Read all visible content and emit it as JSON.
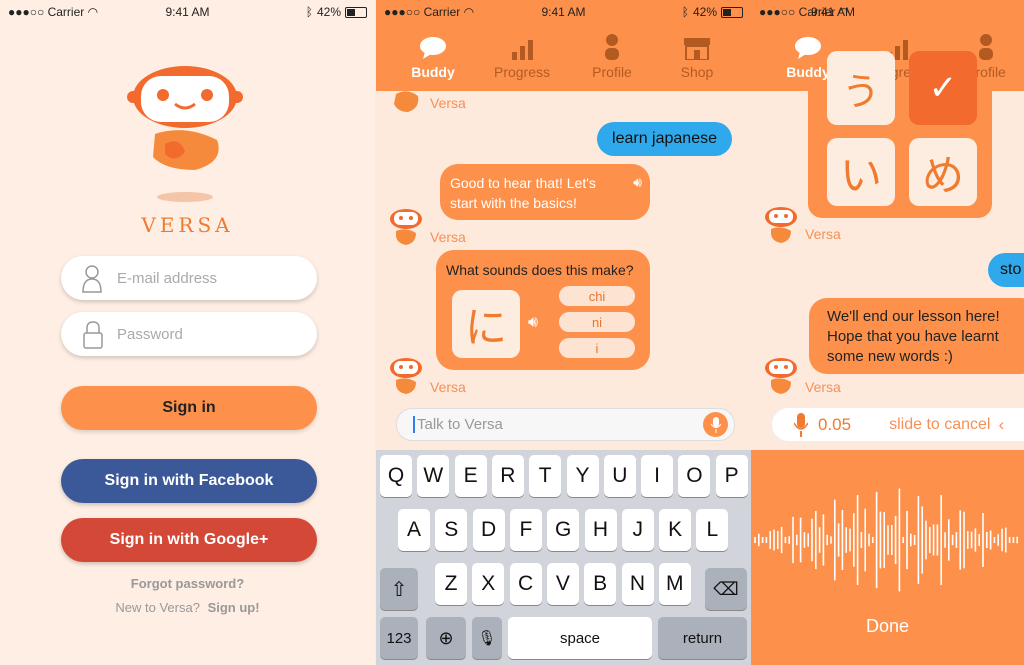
{
  "status": {
    "carrier": "●●●○○ Carrier",
    "time": "9:41 AM",
    "battery": "42%"
  },
  "login": {
    "brand": "VERSA",
    "email_placeholder": "E-mail address",
    "password_placeholder": "Password",
    "signin": "Sign in",
    "facebook": "Sign in with Facebook",
    "google": "Sign in with Google+",
    "forgot": "Forgot password?",
    "new_prompt": "New to Versa?",
    "signup": "Sign up!"
  },
  "nav": {
    "tabs": [
      "Buddy",
      "Progress",
      "Profile",
      "Shop"
    ]
  },
  "chat": {
    "sender": "Versa",
    "user_msg": "learn japanese",
    "bot_msg1": "Good to hear that! Let's start with the basics!",
    "question": "What sounds does this make?",
    "kana": "に",
    "options": [
      "chi",
      "ni",
      "i"
    ],
    "input_placeholder": "Talk to Versa"
  },
  "keyboard": {
    "row1": [
      "Q",
      "W",
      "E",
      "R",
      "T",
      "Y",
      "U",
      "I",
      "O",
      "P"
    ],
    "row2": [
      "A",
      "S",
      "D",
      "F",
      "G",
      "H",
      "J",
      "K",
      "L"
    ],
    "row3": [
      "Z",
      "X",
      "C",
      "V",
      "B",
      "N",
      "M"
    ],
    "num": "123",
    "space": "space",
    "return": "return"
  },
  "screen3": {
    "kana_partial_top": "う",
    "kana_bottom": [
      "い",
      "め"
    ],
    "check": "✓",
    "user_partial": "sto",
    "bot_msg": "We'll end our lesson here! Hope that you have learnt some new words :)",
    "record_time": "0.05",
    "slide": "slide to cancel",
    "done": "Done"
  },
  "colors": {
    "orange": "#fd914b",
    "facebook": "#3b5998",
    "google": "#d34836",
    "user_bubble": "#2fa8ec"
  }
}
